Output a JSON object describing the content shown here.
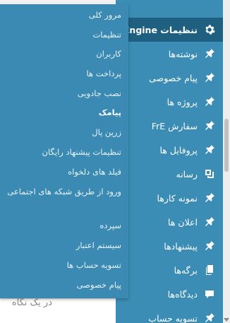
{
  "admin_menu": {
    "items": [
      {
        "label": "تنظیمات Engine",
        "icon": "gear-icon",
        "active": true
      },
      {
        "label": "نوشته‌ها",
        "icon": "pin-icon"
      },
      {
        "label": "پیام خصوصی",
        "icon": "pin-icon"
      },
      {
        "label": "پروژه ها",
        "icon": "pin-icon"
      },
      {
        "label": "سفارش FrE",
        "icon": "pin-icon"
      },
      {
        "label": "پروفایل ها",
        "icon": "pin-icon"
      },
      {
        "label": "رسانه",
        "icon": "media-icon"
      },
      {
        "label": "نمونه کارها",
        "icon": "pin-icon"
      },
      {
        "label": "اعلان ها",
        "icon": "pin-icon"
      },
      {
        "label": "پیشنهادها",
        "icon": "pin-icon"
      },
      {
        "label": "برگه‌ها",
        "icon": "pages-icon"
      },
      {
        "label": "دیدگاه‌ها",
        "icon": "comments-icon"
      },
      {
        "label": "تسویه حساب",
        "icon": "pin-icon"
      }
    ]
  },
  "submenu": {
    "items": [
      {
        "label": "مرور کلی"
      },
      {
        "label": "تنظیمات"
      },
      {
        "label": "کاربران"
      },
      {
        "label": "پرداخت ها"
      },
      {
        "label": "نصب جادویی"
      },
      {
        "label": "پیامک",
        "current": true
      },
      {
        "label": "زرین پال"
      },
      {
        "label": "تنظیمات پیشنهاد رایگان"
      },
      {
        "label": "فیلد های دلخواه"
      },
      {
        "label": "ورود از طریق شبکه های اجتماعی"
      },
      {
        "label": "سپرده"
      },
      {
        "label": "سیستم اعتبار"
      },
      {
        "label": "تسویه حساب ها"
      },
      {
        "label": "پیام خصوصی"
      }
    ]
  },
  "page_under": {
    "text": "در یک نگاه"
  },
  "colors": {
    "menu_bg": "#3b8db5",
    "active_bg": "#1f5f80",
    "submenu_bg": "#3a8ab3"
  }
}
